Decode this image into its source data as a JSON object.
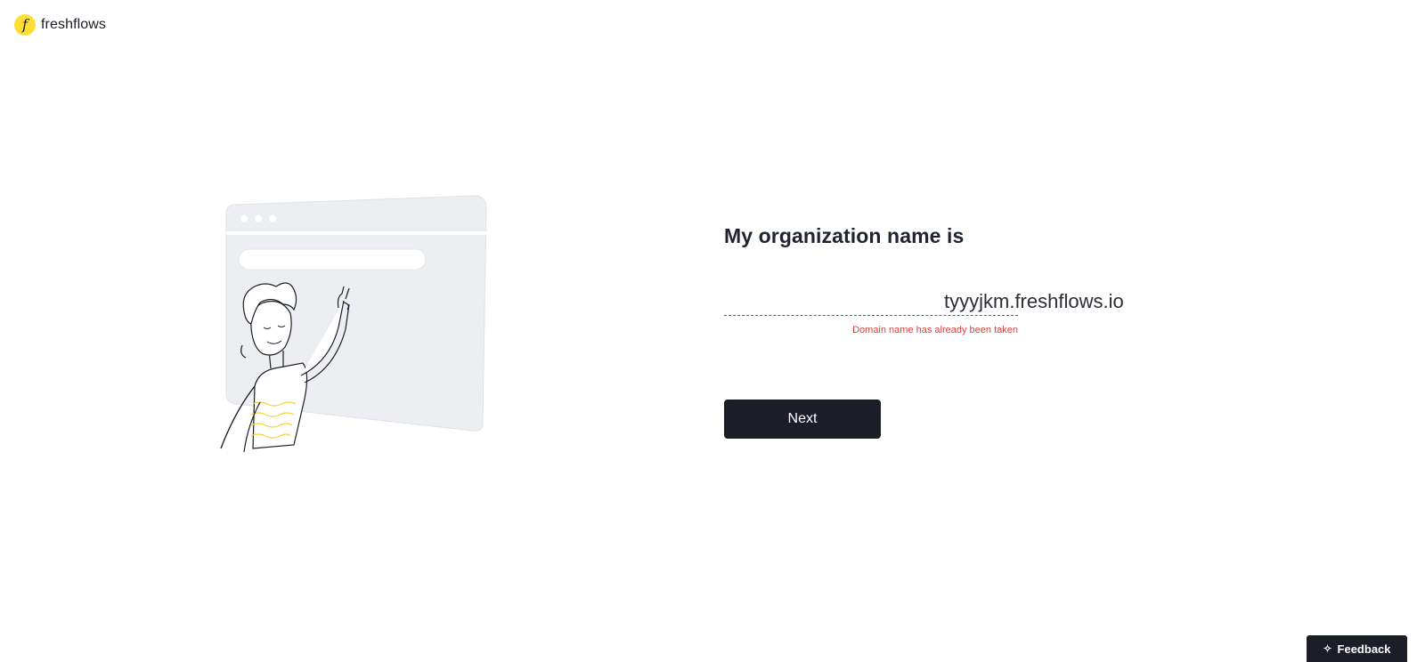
{
  "brand": {
    "mark": "f",
    "name": "freshflows"
  },
  "form": {
    "title": "My organization name is",
    "domain_value": "tyyyjkm",
    "domain_suffix": ".freshflows.io",
    "error": "Domain name has already been taken",
    "next_label": "Next"
  },
  "feedback": {
    "label": "Feedback",
    "icon": "sparkle-icon"
  },
  "colors": {
    "brand_yellow": "#ffde38",
    "button_dark": "#1b1e27",
    "error_red": "#e0403a",
    "illustration_gray": "#eceef1"
  }
}
